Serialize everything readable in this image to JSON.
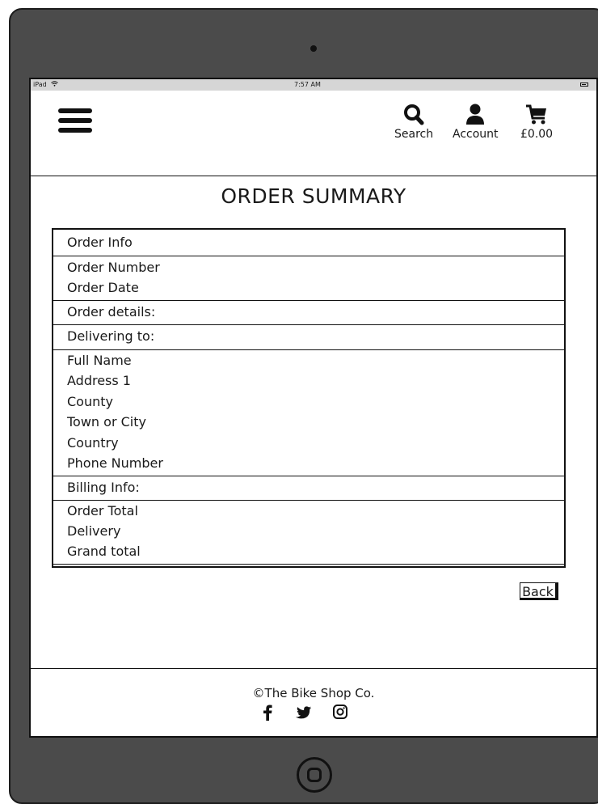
{
  "status_bar": {
    "device": "iPad",
    "time": "7:57 AM"
  },
  "header": {
    "search_label": "Search",
    "account_label": "Account",
    "cart_label": "£0.00"
  },
  "page_title": "ORDER SUMMARY",
  "summary": {
    "order_info_header": "Order Info",
    "order_number": "Order Number",
    "order_date": "Order Date",
    "order_details_header": "Order details:",
    "delivering_header": "Delivering to:",
    "full_name": "Full Name",
    "address_1": "Address 1",
    "county": "County",
    "town": "Town or City",
    "country": "Country",
    "phone": "Phone Number",
    "billing_header": "Billing Info:",
    "order_total": "Order Total",
    "delivery": "Delivery",
    "grand_total": "Grand total"
  },
  "back_label": "Back",
  "footer": {
    "copyright": "©The Bike Shop Co."
  }
}
